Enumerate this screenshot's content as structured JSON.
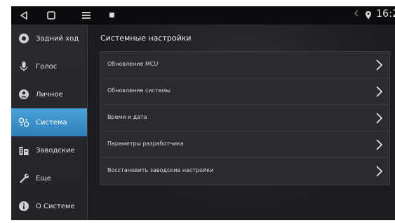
{
  "status_bar": {
    "time": "16:2",
    "signal_icon": "signal-icon",
    "location_icon": "location-icon"
  },
  "sidebar": {
    "items": [
      {
        "label": "Задний ход",
        "icon": "camera-icon"
      },
      {
        "label": "Голос",
        "icon": "microphone-icon"
      },
      {
        "label": "Личное",
        "icon": "person-icon"
      },
      {
        "label": "Система",
        "icon": "toggle-icon",
        "active": true
      },
      {
        "label": "Заводские",
        "icon": "building-icon"
      },
      {
        "label": "Еще",
        "icon": "wrench-icon"
      },
      {
        "label": "О Системе",
        "icon": "info-icon"
      }
    ]
  },
  "main": {
    "title": "Системные настройки",
    "settings": [
      {
        "label": "Обновление MCU"
      },
      {
        "label": "Обновление системы"
      },
      {
        "label": "Время и дата"
      },
      {
        "label": "Параметры разработчика"
      },
      {
        "label": "Восстановить заводские настройки"
      }
    ]
  },
  "colors": {
    "accent": "#3b8fcb",
    "background": "#1b1b1e"
  }
}
